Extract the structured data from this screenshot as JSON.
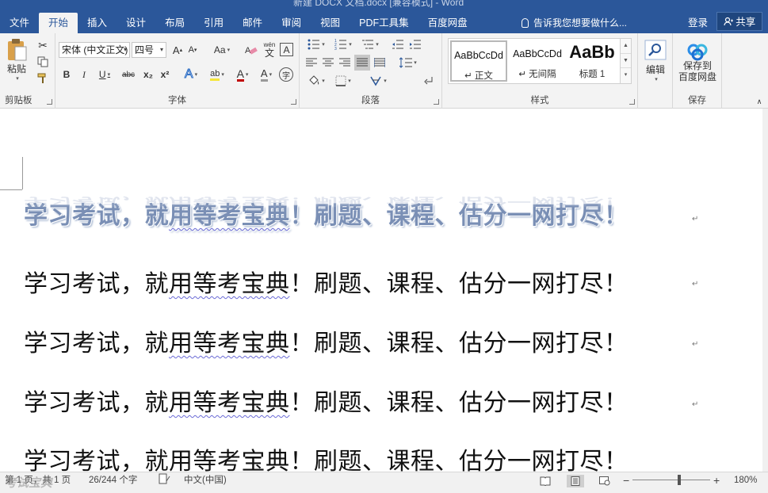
{
  "window": {
    "title": "新建 DOCX 文档.docx [兼容模式] - Word"
  },
  "menu": {
    "tabs": [
      "文件",
      "开始",
      "插入",
      "设计",
      "布局",
      "引用",
      "邮件",
      "审阅",
      "视图",
      "PDF工具集",
      "百度网盘"
    ],
    "active_tab": "开始",
    "tell_me": "告诉我您想要做什么...",
    "login": "登录",
    "share": "共享"
  },
  "ribbon": {
    "clipboard": {
      "label": "剪贴板",
      "paste": "粘贴"
    },
    "font": {
      "label": "字体",
      "font_name": "宋体 (中文正文)",
      "font_size": "四号",
      "bold": "B",
      "italic": "I",
      "underline": "U",
      "strike": "abc",
      "subscript": "x₂",
      "superscript": "x²",
      "grow": "A",
      "shrink": "A",
      "case": "Aa",
      "phonetic": "wén",
      "border_char": "A"
    },
    "paragraph": {
      "label": "段落"
    },
    "styles": {
      "label": "样式",
      "items": [
        {
          "sample": "AaBbCcDd",
          "name": "↵ 正文"
        },
        {
          "sample": "AaBbCcDd",
          "name": "↵ 无间隔"
        },
        {
          "sample": "AaBb",
          "name": "标题 1"
        }
      ]
    },
    "editing": {
      "label": "编辑"
    },
    "save": {
      "label": "保存",
      "button_line1": "保存到",
      "button_line2": "百度网盘"
    }
  },
  "document": {
    "lines": [
      {
        "a": "学习考试，就",
        "u": "用等考宝典",
        "b": "！刷题、课程、估分一网打尽！"
      },
      {
        "a": "学习考试，就",
        "u": "用等考宝典",
        "b": "！刷题、课程、估分一网打尽！"
      },
      {
        "a": "学习考试，就",
        "u": "用等考宝典",
        "b": "！刷题、课程、估分一网打尽！"
      },
      {
        "a": "学习考试，就",
        "u": "用等考宝典",
        "b": "！刷题、课程、估分一网打尽！"
      },
      {
        "a": "学习考试，就",
        "u": "用等考宝典",
        "b": "！刷题、课程、估分一网打尽！"
      }
    ],
    "para_mark": "↵"
  },
  "status": {
    "page": "第 1 页，共 1 页",
    "words": "26/244 个字",
    "language": "中文(中国)",
    "zoom": "180%",
    "zoom_value": 180,
    "watermark": "考试宝典"
  },
  "colors": {
    "brand": "#2b579a",
    "fancy_text": "#7a8fb5"
  }
}
